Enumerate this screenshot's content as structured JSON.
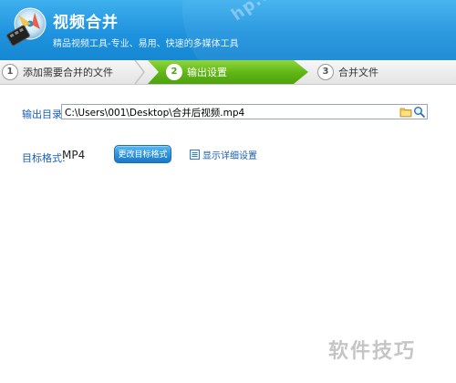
{
  "header": {
    "title": "视频合并",
    "subtitle": "精品视频工具-专业、易用、快速的多媒体工具",
    "watermark": "hp.cn"
  },
  "steps": [
    {
      "num": "1",
      "label": "添加需要合并的文件",
      "active": false
    },
    {
      "num": "2",
      "label": "输出设置",
      "active": true
    },
    {
      "num": "3",
      "label": "合并文件",
      "active": false
    }
  ],
  "output": {
    "label": "输出目录:",
    "path": "C:\\Users\\001\\Desktop\\合并后视频.mp4"
  },
  "format": {
    "label": "目标格式:",
    "value": "MP4",
    "change_button": "更改目标格式",
    "detail_link": "显示详细设置"
  },
  "watermark_bottom": "软件技巧",
  "colors": {
    "header_blue": "#1f93de",
    "step_active_green": "#5fb514",
    "label_blue": "#1a5fb4",
    "button_blue": "#2a8edb"
  },
  "icons": {
    "logo": "film-app-logo-icon",
    "folder": "folder-icon",
    "search": "search-icon",
    "detail": "settings-list-icon"
  }
}
